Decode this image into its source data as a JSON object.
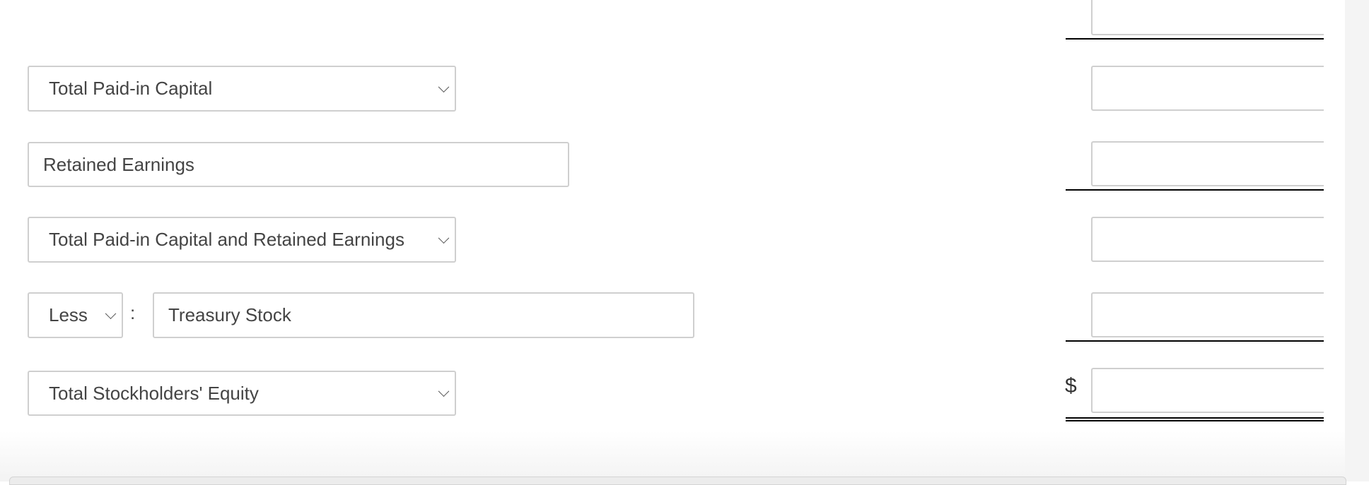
{
  "rows": [
    {
      "type": "select",
      "value": "Total Paid-in Capital"
    },
    {
      "type": "input",
      "value": "Retained Earnings"
    },
    {
      "type": "select",
      "value": "Total Paid-in Capital and Retained Earnings"
    },
    {
      "type": "select+input",
      "modifier": "Less",
      "separator": ":",
      "value": "Treasury Stock"
    },
    {
      "type": "select",
      "value": "Total Stockholders' Equity"
    }
  ],
  "amounts": [
    "",
    "",
    "",
    "",
    "",
    ""
  ],
  "currency_symbol": "$"
}
